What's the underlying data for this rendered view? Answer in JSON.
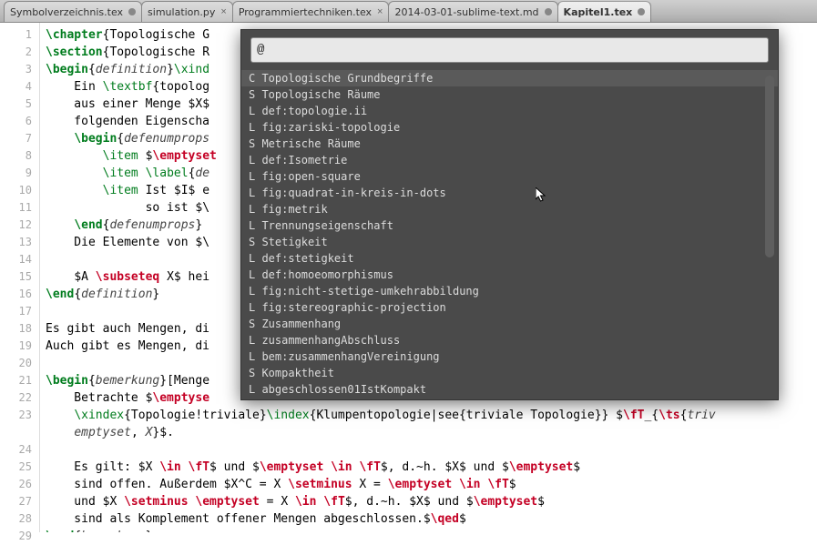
{
  "tabs": [
    {
      "label": "Symbolverzeichnis.tex",
      "dirty": true,
      "x": true
    },
    {
      "label": "simulation.py",
      "dirty": false,
      "x": true
    },
    {
      "label": "Programmiertechniken.tex",
      "dirty": false,
      "x": true
    },
    {
      "label": "2014-03-01-sublime-text.md",
      "dirty": true,
      "x": true
    },
    {
      "label": "Kapitel1.tex",
      "dirty": true,
      "x": true,
      "active": true
    }
  ],
  "lines": [
    1,
    2,
    3,
    4,
    5,
    6,
    7,
    8,
    9,
    10,
    11,
    12,
    13,
    14,
    15,
    16,
    17,
    18,
    19,
    20,
    21,
    22,
    23,
    "",
    24,
    25,
    26,
    27,
    28,
    29
  ],
  "code": [
    "<span class='cmd'>\\chapter</span>{Topologische G",
    "<span class='cmd'>\\section</span>{Topologische R",
    "<span class='cmd'>\\begin</span>{<span class='arg'>definition</span>}<span class='green'>\\xind</span>",
    "    Ein <span class='green'>\\textbf</span>{topolog",
    "    aus einer Menge <span class='math'>$X$</span>",
    "    folgenden Eigenscha                                                            ssene",
    "    <span class='cmd'>\\begin</span>{<span class='arg'>defenumprops</span>",
    "        <span class='green'>\\item</span> <span class='math'>$</span><span class='kw'>\\emptyset</span>",
    "        <span class='green'>\\item</span> <span class='green'>\\label</span>{<span class='arg'>de</span>                                                                    <span class='red'>\\fT</span><span class='math'>$</span>",
    "        <span class='green'>\\item</span> Ist <span class='math'>$I$</span> e",
    "              so ist <span class='math'>$\\</span>",
    "    <span class='cmd'>\\end</span>{<span class='arg'>defenumprops</span>}",
    "    Die Elemente von <span class='math'>$\\</span>",
    "",
    "    <span class='math'>$A</span> <span class='kw'>\\subseteq</span> <span class='math'>X$</span> hei",
    "<span class='cmd'>\\end</span>{<span class='arg'>definition</span>}",
    "",
    "Es gibt auch Mengen, di",
    "Auch gibt es Mengen, di",
    "",
    "<span class='cmd'>\\begin</span>{<span class='arg'>bemerkung</span>}[Menge",
    "    Betrachte <span class='math'>$</span><span class='kw'>\\emptyse</span>",
    "    <span class='green'>\\xindex</span>{Topologie!triviale}<span class='green'>\\index</span>{Klumpentopologie|see{triviale Topologie}} <span class='math'>$</span><span class='kw'>\\fT</span><span class='math'>_{</span><span class='kw'>\\ts</span>{<span class='arg'>triv</span>",
    "    <span class='arg'>emptyset</span>, <span class='arg'>X</span>}<span class='math'>$</span>.",
    "",
    "    Es gilt: <span class='math'>$X</span> <span class='kw'>\\in</span> <span class='kw'>\\fT</span><span class='math'>$</span> und <span class='math'>$</span><span class='kw'>\\emptyset</span> <span class='kw'>\\in</span> <span class='kw'>\\fT</span><span class='math'>$</span>, d.~h. <span class='math'>$X$</span> und <span class='math'>$</span><span class='kw'>\\emptyset</span><span class='math'>$</span>",
    "    sind offen. Außerdem <span class='math'>$X^C = X</span> <span class='kw'>\\setminus</span> <span class='math'>X =</span> <span class='kw'>\\emptyset</span> <span class='kw'>\\in</span> <span class='kw'>\\fT</span><span class='math'>$</span>",
    "    und <span class='math'>$X</span> <span class='kw'>\\setminus</span> <span class='kw'>\\emptyset</span> <span class='math'>= X</span> <span class='kw'>\\in</span> <span class='kw'>\\fT</span><span class='math'>$</span>, d.~h. <span class='math'>$X$</span> und <span class='math'>$</span><span class='kw'>\\emptyset</span><span class='math'>$</span>",
    "    sind als Komplement offener Mengen abgeschlossen.<span class='math'>$</span><span class='kw'>\\qed</span><span class='math'>$</span>",
    "<span class='cmd'>\\end</span>{<span class='arg'>bemerkung</span>}"
  ],
  "popup": {
    "query": "@",
    "items": [
      {
        "pre": "C",
        "label": "Topologische Grundbegriffe",
        "sel": true
      },
      {
        "pre": "S",
        "label": "Topologische Räume"
      },
      {
        "pre": "L",
        "label": "def:topologie.ii"
      },
      {
        "pre": "L",
        "label": "fig:zariski-topologie"
      },
      {
        "pre": "S",
        "label": "Metrische Räume"
      },
      {
        "pre": "L",
        "label": "def:Isometrie"
      },
      {
        "pre": "L",
        "label": "fig:open-square"
      },
      {
        "pre": "L",
        "label": "fig:quadrat-in-kreis-in-dots"
      },
      {
        "pre": "L",
        "label": "fig:metrik"
      },
      {
        "pre": "L",
        "label": "Trennungseigenschaft"
      },
      {
        "pre": "S",
        "label": "Stetigkeit"
      },
      {
        "pre": "L",
        "label": "def:stetigkeit"
      },
      {
        "pre": "L",
        "label": "def:homoeomorphismus"
      },
      {
        "pre": "L",
        "label": "fig:nicht-stetige-umkehrabbildung"
      },
      {
        "pre": "L",
        "label": "fig:stereographic-projection"
      },
      {
        "pre": "S",
        "label": "Zusammenhang"
      },
      {
        "pre": "L",
        "label": "zusammenhangAbschluss"
      },
      {
        "pre": "L",
        "label": "bem:zusammenhangVereinigung"
      },
      {
        "pre": "S",
        "label": "Kompaktheit"
      },
      {
        "pre": "L",
        "label": "abgeschlossen01IstKompakt"
      }
    ]
  }
}
